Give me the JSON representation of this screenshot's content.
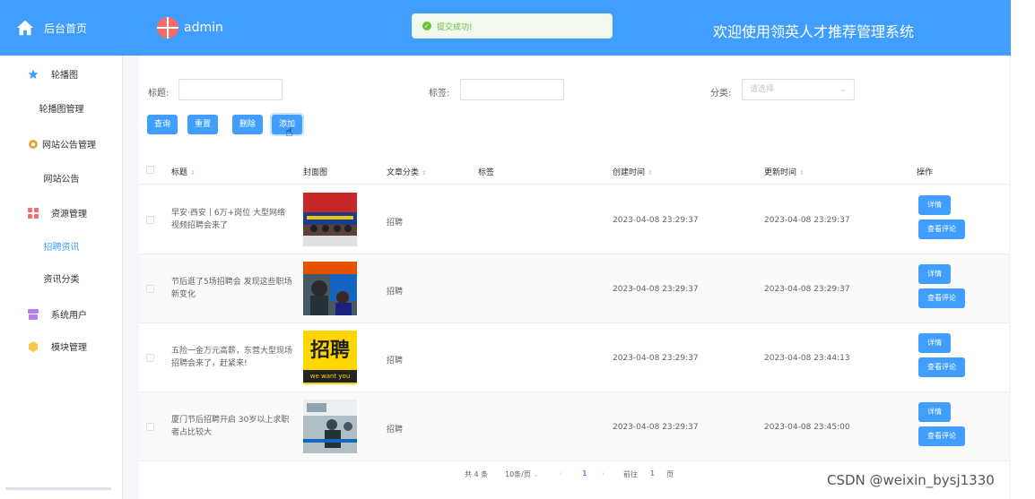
{
  "header": {
    "brand": "后台首页",
    "user": "admin",
    "welcome": "欢迎使用领英人才推荐管理系统",
    "toast": "提交成功!"
  },
  "sidebar": {
    "items": [
      {
        "label": "轮播图",
        "icon": "star-icon",
        "color": "#409eff"
      },
      {
        "label": "轮播图管理"
      },
      {
        "label": "网站公告管理",
        "icon": "gear-icon",
        "color": "#e6a23c"
      },
      {
        "label": "网站公告"
      },
      {
        "label": "资源管理",
        "icon": "grid-icon",
        "color": "#f56c6c"
      },
      {
        "label": "招聘资讯"
      },
      {
        "label": "资讯分类"
      },
      {
        "label": "系统用户",
        "icon": "box-icon",
        "color": "#b37feb"
      },
      {
        "label": "模块管理",
        "icon": "hexagon-icon",
        "color": "#f7c948"
      }
    ]
  },
  "search": {
    "title_label": "标题:",
    "tag_label": "标签:",
    "category_label": "分类:",
    "category_placeholder": "请选择",
    "buttons": [
      "查询",
      "重置",
      "删除",
      "添加"
    ]
  },
  "table": {
    "headers": [
      "标题",
      "封面图",
      "文章分类",
      "标签",
      "创建时间",
      "更新时间",
      "操作"
    ],
    "rows": [
      {
        "title": "早安·西安丨6万+岗位 大型网络视频招聘会来了",
        "category": "招聘",
        "tag": "",
        "created": "2023-04-08 23:29:37",
        "updated": "2023-04-08 23:29:37"
      },
      {
        "title": "节后逛了5场招聘会 发现这些职场新变化",
        "category": "招聘",
        "tag": "",
        "created": "2023-04-08 23:29:37",
        "updated": "2023-04-08 23:29:37"
      },
      {
        "title": "五险一金万元高薪，东营大型现场招聘会来了，赶紧来!",
        "category": "招聘",
        "tag": "",
        "created": "2023-04-08 23:29:37",
        "updated": "2023-04-08 23:44:13"
      },
      {
        "title": "厦门节后招聘开启 30岁以上求职者占比较大",
        "category": "招聘",
        "tag": "",
        "created": "2023-04-08 23:29:37",
        "updated": "2023-04-08 23:45:00"
      }
    ],
    "action_detail": "详情",
    "action_comments": "查看评论",
    "thumb3_title": "招聘",
    "thumb3_caption": "we want you"
  },
  "pagination": {
    "total": "共 4 条",
    "page_size": "10条/页",
    "current_page": "1",
    "goto_label": "前往",
    "goto_value": "1",
    "page_suffix": "页"
  },
  "watermark": "CSDN @weixin_bysj1330"
}
